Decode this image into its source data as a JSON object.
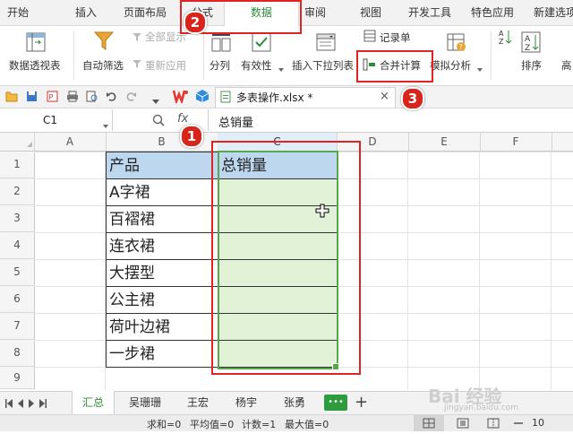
{
  "menu": {
    "items": [
      "开始",
      "插入",
      "页面布局",
      "公式",
      "数据",
      "审阅",
      "视图",
      "开发工具",
      "特色应用",
      "新建选项卡"
    ],
    "active": "数据"
  },
  "ribbon": {
    "pivot_table": "数据透视表",
    "auto_filter": "自动筛选",
    "show_all": "全部显示",
    "reapply": "重新应用",
    "split_columns": "分列",
    "validity": "有效性",
    "insert_dropdown": "插入下拉列表",
    "record_form": "记录单",
    "consolidate": "合并计算",
    "what_if": "模拟分析",
    "sort": "排序",
    "advanced_partial": "高"
  },
  "document": {
    "tab_title": "多表操作.xlsx *"
  },
  "formula_bar": {
    "name_box": "C1",
    "fx": "fx",
    "content": "总销量"
  },
  "grid": {
    "columns": [
      "A",
      "B",
      "C",
      "D",
      "E",
      "F"
    ],
    "rows": [
      "1",
      "2",
      "3",
      "4",
      "5",
      "6",
      "7",
      "8",
      "9"
    ],
    "b_values": [
      "产品",
      "A字裙",
      "百褶裙",
      "连衣裙",
      "大摆型",
      "公主裙",
      "荷叶边裙",
      "一步裙"
    ],
    "c1": "总销量"
  },
  "sheets": {
    "tabs": [
      "汇总",
      "吴珊珊",
      "王宏",
      "杨宇",
      "张勇"
    ],
    "active": "汇总",
    "more": "•••",
    "add": "+"
  },
  "status": {
    "sum": "求和=0",
    "avg": "平均值=0",
    "count": "计数=1",
    "max": "最大值=0",
    "zoom_partial": "10"
  },
  "annotations": {
    "badge1": "1",
    "badge2": "2",
    "badge3": "3"
  },
  "watermark": {
    "text": "Bai 经验",
    "url": "jingyan.baidu.com"
  },
  "colors": {
    "accent_green": "#2e8b3a",
    "annotation_red": "#e02424",
    "header_fill": "#bdd7ee",
    "selection_fill": "#e2f2d6"
  }
}
